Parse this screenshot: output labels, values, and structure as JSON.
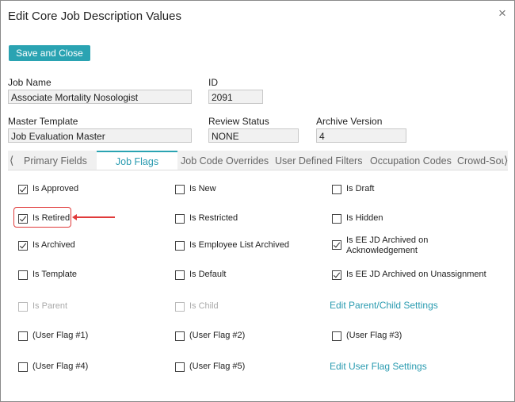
{
  "dialog": {
    "title": "Edit Core Job Description Values",
    "close_icon": "×",
    "save_label": "Save and Close"
  },
  "fields": {
    "job_name": {
      "label": "Job Name",
      "value": "Associate Mortality Nosologist"
    },
    "id": {
      "label": "ID",
      "value": "2091"
    },
    "master_template": {
      "label": "Master Template",
      "value": "Job Evaluation Master"
    },
    "review_status": {
      "label": "Review Status",
      "value": "NONE"
    },
    "archive_version": {
      "label": "Archive Version",
      "value": "4"
    }
  },
  "tabs": {
    "left_arrow": "⟨",
    "right_arrow": "⟩",
    "items": [
      {
        "label": "Primary Fields"
      },
      {
        "label": "Job Flags",
        "active": true
      },
      {
        "label": "Job Code Overrides"
      },
      {
        "label": "User Defined Filters"
      },
      {
        "label": "Occupation Codes"
      },
      {
        "label": "Crowd-Sourcing"
      }
    ]
  },
  "flags": {
    "is_approved": {
      "label": "Is Approved",
      "checked": true
    },
    "is_new": {
      "label": "Is New",
      "checked": false
    },
    "is_draft": {
      "label": "Is Draft",
      "checked": false
    },
    "is_retired": {
      "label": "Is Retired",
      "checked": true
    },
    "is_restricted": {
      "label": "Is Restricted",
      "checked": false
    },
    "is_hidden": {
      "label": "Is Hidden",
      "checked": false
    },
    "is_archived": {
      "label": "Is Archived",
      "checked": true
    },
    "is_employee_list_archived": {
      "label": "Is Employee List Archived",
      "checked": false
    },
    "is_ee_jd_archived_ack": {
      "label": "Is EE JD Archived on Acknowledgement",
      "checked": true
    },
    "is_template": {
      "label": "Is Template",
      "checked": false
    },
    "is_default": {
      "label": "Is Default",
      "checked": false
    },
    "is_ee_jd_archived_unassign": {
      "label": "Is EE JD Archived on Unassignment",
      "checked": true
    },
    "is_parent": {
      "label": "Is Parent",
      "checked": false,
      "disabled": true
    },
    "is_child": {
      "label": "Is Child",
      "checked": false,
      "disabled": true
    },
    "user_flag_1": {
      "label": "(User Flag #1)",
      "checked": false
    },
    "user_flag_2": {
      "label": "(User Flag #2)",
      "checked": false
    },
    "user_flag_3": {
      "label": "(User Flag #3)",
      "checked": false
    },
    "user_flag_4": {
      "label": "(User Flag #4)",
      "checked": false
    },
    "user_flag_5": {
      "label": "(User Flag #5)",
      "checked": false
    }
  },
  "links": {
    "parent_child": "Edit Parent/Child Settings",
    "user_flag": "Edit User Flag Settings"
  },
  "colors": {
    "accent": "#2aa3b2",
    "annotation": "#e03a3a"
  }
}
